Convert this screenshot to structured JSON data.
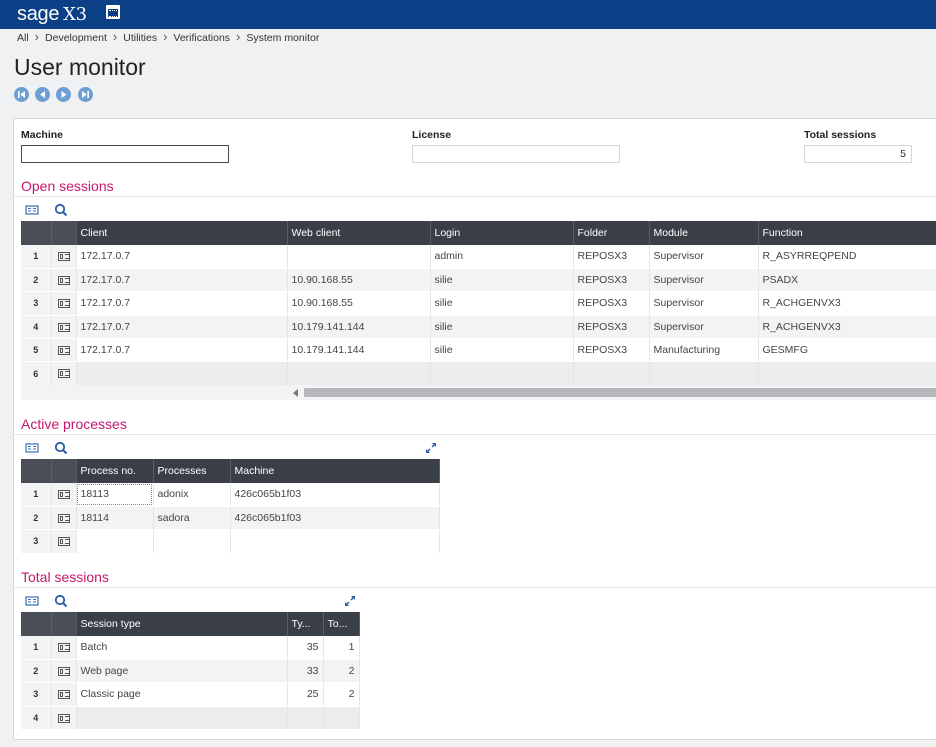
{
  "app": {
    "logo": "sage",
    "logo_suffix": "X3",
    "calendar_icon": "calendar-icon"
  },
  "breadcrumb": [
    "All",
    "Development",
    "Utilities",
    "Verifications",
    "System monitor"
  ],
  "page_title": "User monitor",
  "nav_buttons": [
    "first-record-icon",
    "previous-record-icon",
    "next-record-icon",
    "last-record-icon"
  ],
  "fields": {
    "machine": {
      "label": "Machine",
      "value": ""
    },
    "license": {
      "label": "License",
      "value": ""
    },
    "total_sessions": {
      "label": "Total sessions",
      "value": "5"
    }
  },
  "open_sessions": {
    "title": "Open sessions",
    "columns": [
      "Client",
      "Web client",
      "Login",
      "Folder",
      "Module",
      "Function"
    ],
    "rows": [
      [
        "172.17.0.7",
        "",
        "admin",
        "REPOSX3",
        "Supervisor",
        "R_ASYRREQPEND"
      ],
      [
        "172.17.0.7",
        "10.90.168.55",
        "silie",
        "REPOSX3",
        "Supervisor",
        "PSADX"
      ],
      [
        "172.17.0.7",
        "10.90.168.55",
        "silie",
        "REPOSX3",
        "Supervisor",
        "R_ACHGENVX3"
      ],
      [
        "172.17.0.7",
        "10.179.141.144",
        "silie",
        "REPOSX3",
        "Supervisor",
        "R_ACHGENVX3"
      ],
      [
        "172.17.0.7",
        "10.179.141.144",
        "silie",
        "REPOSX3",
        "Manufacturing",
        "GESMFG"
      ]
    ],
    "empty_row_number": "6"
  },
  "active_processes": {
    "title": "Active processes",
    "columns": [
      "Process no.",
      "Processes",
      "Machine"
    ],
    "rows": [
      [
        "18113",
        "adonix",
        "426c065b1f03"
      ],
      [
        "18114",
        "sadora",
        "426c065b1f03"
      ]
    ],
    "empty_row_number": "3"
  },
  "total_sessions": {
    "title": "Total sessions",
    "columns": [
      "Session type",
      "Ty...",
      "To..."
    ],
    "rows": [
      [
        "Batch",
        "35",
        "1"
      ],
      [
        "Web page",
        "33",
        "2"
      ],
      [
        "Classic page",
        "25",
        "2"
      ]
    ],
    "empty_row_number": "4"
  },
  "colors": {
    "topbar": "#0b3f86",
    "section_title": "#c4186e",
    "grid_header": "#3a3f47",
    "nav_button": "#6d9fd6"
  }
}
